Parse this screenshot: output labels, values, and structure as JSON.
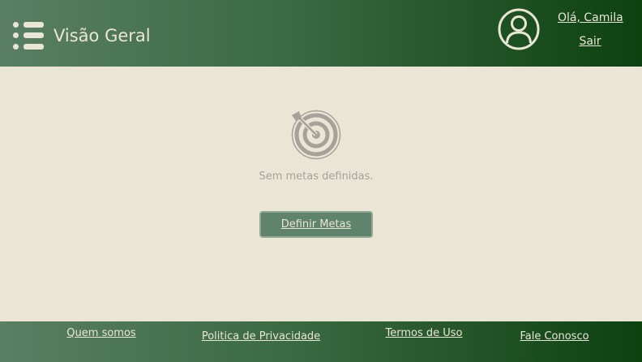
{
  "header": {
    "title": "Visão Geral",
    "menu_icon": "list-icon",
    "avatar_icon": "user-circle-icon",
    "greeting": "Olá, Camila",
    "logout_label": "Sair"
  },
  "main": {
    "empty_icon": "target-icon",
    "empty_message": "Sem metas definidas.",
    "define_goals_label": "Definir Metas"
  },
  "footer": {
    "links": [
      "Quem somos",
      "Politica de Privacidade",
      "Termos de Uso",
      "Fale Conosco"
    ]
  },
  "colors": {
    "background": "#ebe5d5",
    "bar_gradient_start": "#5a7f63",
    "bar_gradient_end": "#0d4110",
    "button": "#5f836b",
    "muted_text": "#a6a29a"
  }
}
